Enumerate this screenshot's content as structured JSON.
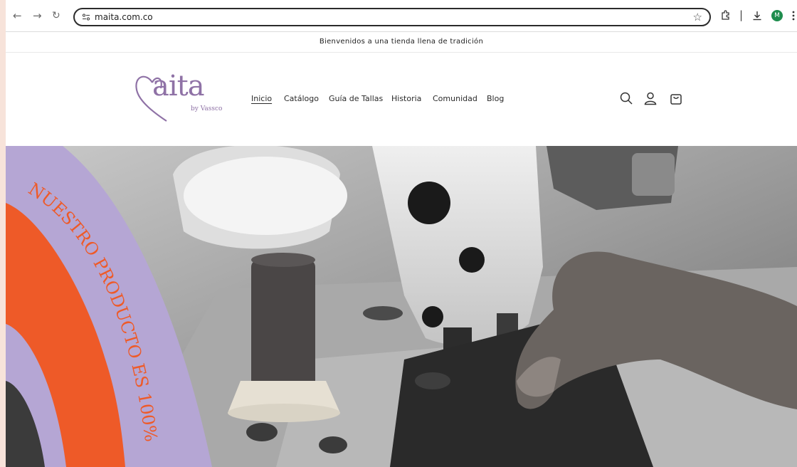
{
  "browser": {
    "url": "maita.com.co",
    "avatar_letter": "M",
    "icons": [
      "back-icon",
      "forward-icon",
      "reload-icon",
      "site-info-icon",
      "bookmark-star-icon",
      "extensions-icon",
      "download-icon",
      "menu-kebab-icon"
    ]
  },
  "announcement": "Bienvenidos a una tienda llena de tradición",
  "brand": {
    "name": "aita",
    "sub": "by Vassco",
    "color": "#8f72a6"
  },
  "nav": {
    "items": [
      "Inicio",
      "Catálogo",
      "Guía de Tallas",
      "Historia",
      "Comunidad",
      "Blog"
    ],
    "active": "Inicio"
  },
  "header_icons": [
    "search-icon",
    "account-icon",
    "cart-icon"
  ],
  "hero": {
    "curved_text": "NUESTRO PRODUCTO ES 100%",
    "colors": {
      "lavender": "#b5a6d4",
      "orange": "#ee5a28"
    }
  }
}
